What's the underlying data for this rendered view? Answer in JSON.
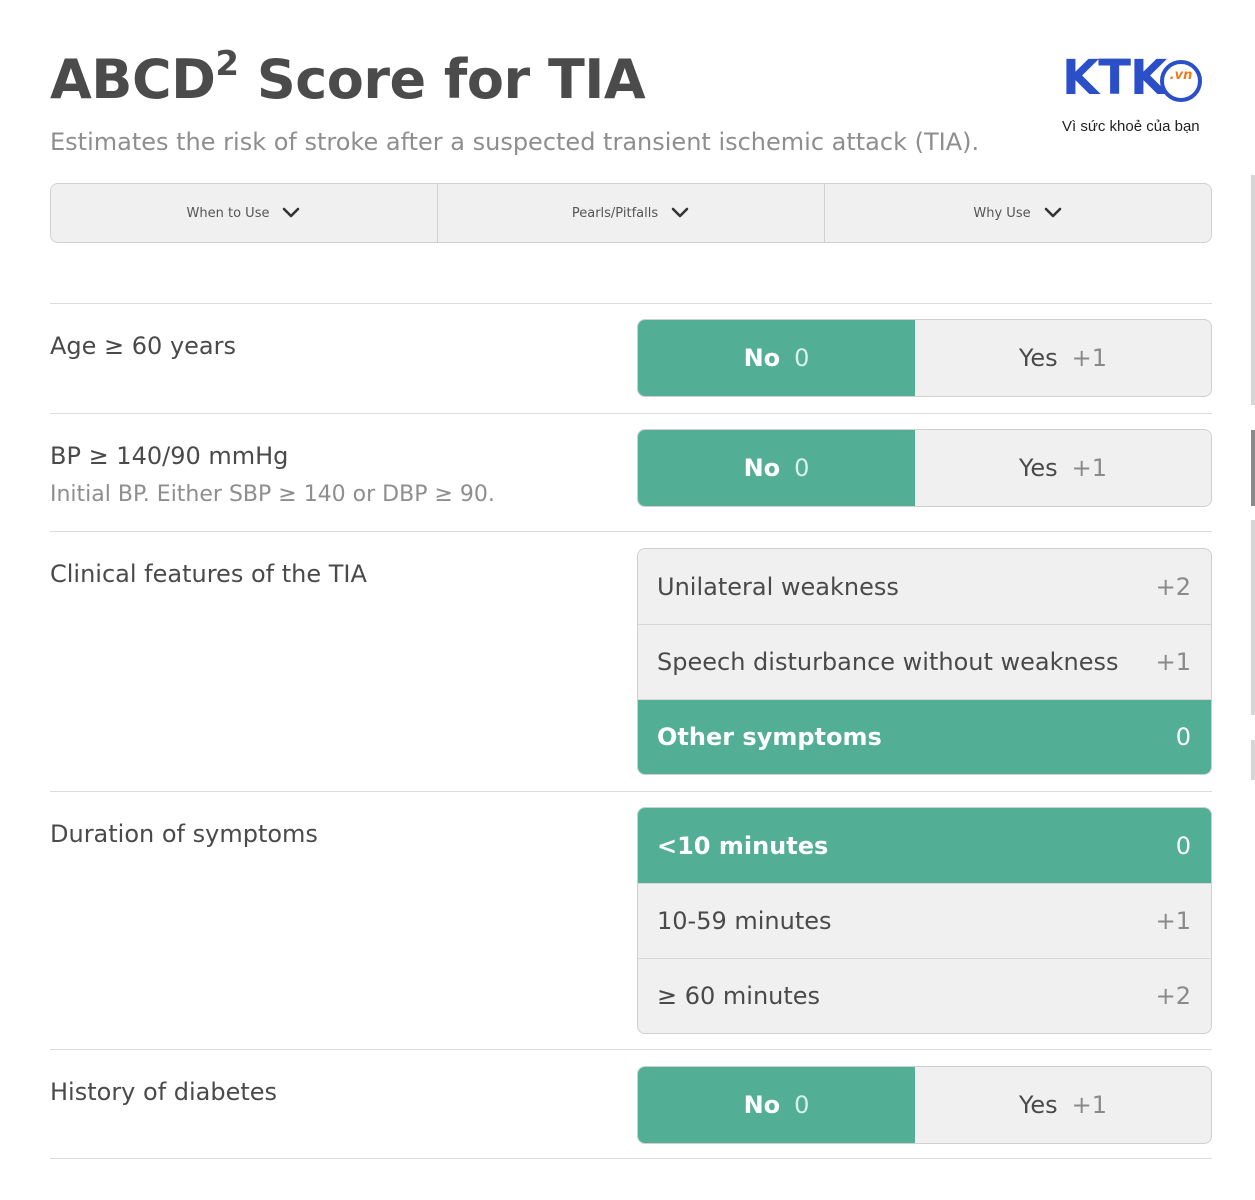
{
  "header": {
    "title": "ABCD",
    "title_sup": "2",
    "title_rest": " Score for TIA",
    "subtitle": "Estimates the risk of stroke after a suspected transient ischemic attack (TIA)."
  },
  "logo": {
    "mark": "KTK",
    "domain": ".vn",
    "tagline": "Vì sức khoẻ của bạn"
  },
  "tabs": [
    {
      "label": "When to Use"
    },
    {
      "label": "Pearls/Pitfalls"
    },
    {
      "label": "Why Use"
    }
  ],
  "questions": {
    "age": {
      "label": "Age ≥ 60 years",
      "no_label": "No",
      "no_points": "0",
      "yes_label": "Yes",
      "yes_points": "+1",
      "selected": "No"
    },
    "bp": {
      "label": "BP ≥ 140/90 mmHg",
      "sublabel": "Initial BP. Either SBP ≥ 140 or DBP ≥ 90.",
      "no_label": "No",
      "no_points": "0",
      "yes_label": "Yes",
      "yes_points": "+1",
      "selected": "No"
    },
    "clinical": {
      "label": "Clinical features of the TIA",
      "options": [
        {
          "label": "Unilateral weakness",
          "points": "+2"
        },
        {
          "label": "Speech disturbance without weakness",
          "points": "+1"
        },
        {
          "label": "Other symptoms",
          "points": "0"
        }
      ],
      "selected": "Other symptoms"
    },
    "duration": {
      "label": "Duration of symptoms",
      "options": [
        {
          "label": "<10 minutes",
          "points": "0"
        },
        {
          "label": "10-59 minutes",
          "points": "+1"
        },
        {
          "label": "≥ 60 minutes",
          "points": "+2"
        }
      ],
      "selected": "<10 minutes"
    },
    "diabetes": {
      "label": "History of diabetes",
      "no_label": "No",
      "no_points": "0",
      "yes_label": "Yes",
      "yes_points": "+1",
      "selected": "No"
    }
  },
  "colors": {
    "selected": "#52ae95",
    "logo_blue": "#2b4fc9",
    "logo_orange": "#f07a1e"
  }
}
